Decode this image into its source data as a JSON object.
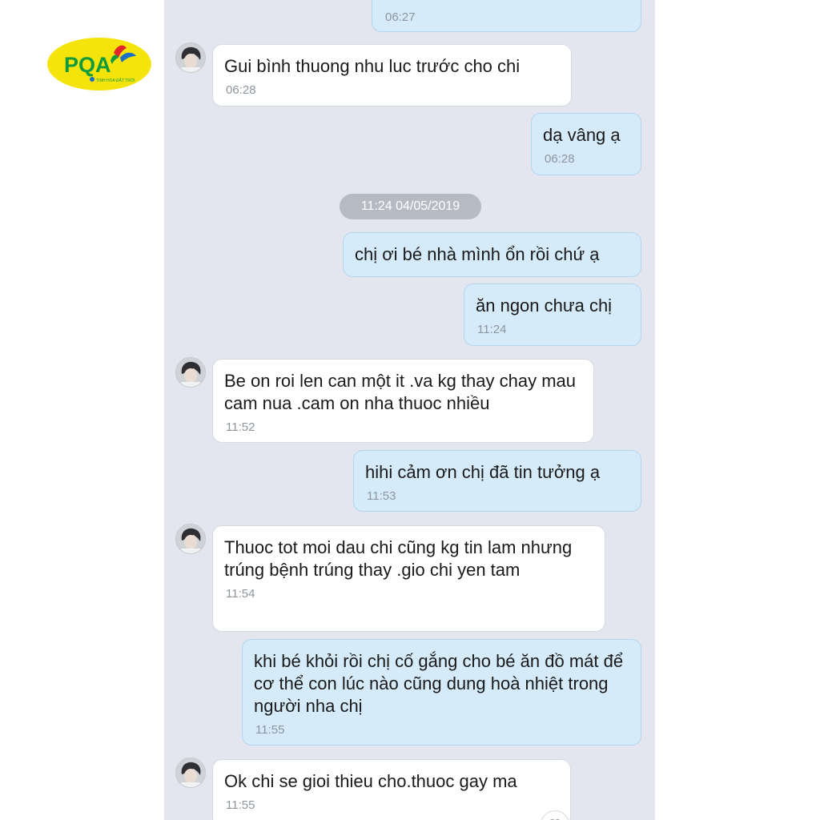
{
  "logo": {
    "brand": "PQA",
    "tagline": "TINH HOA ĐẤT TRỜI",
    "colors": {
      "yellow": "#f4e40c",
      "green": "#0f9b3c",
      "red": "#e3262e",
      "blue": "#1c6fc4"
    }
  },
  "chat": {
    "background": "#e3e6ee",
    "date_divider": "11:24 04/05/2019",
    "messages": [
      {
        "side": "out",
        "text": "",
        "time": "06:27"
      },
      {
        "side": "in",
        "text": "Gui bình thuong nhu luc trước cho chi",
        "time": "06:28"
      },
      {
        "side": "out",
        "text": "dạ vâng ạ",
        "time": "06:28"
      },
      {
        "side": "out",
        "text": "chị ơi bé nhà mình ổn rồi chứ ạ",
        "time": ""
      },
      {
        "side": "out",
        "text": "ăn ngon chưa chị",
        "time": "11:24"
      },
      {
        "side": "in",
        "text": "Be on roi len can một it .va kg thay chay mau cam nua .cam on nha thuoc nhiều",
        "time": "11:52"
      },
      {
        "side": "out",
        "text": "hihi cảm ơn chị đã tin tưởng ạ",
        "time": "11:53"
      },
      {
        "side": "in",
        "text": "Thuoc tot moi dau chi cũng kg tin lam nhưng trúng bệnh trúng thay .gio chi yen tam",
        "time": "11:54"
      },
      {
        "side": "out",
        "text": "khi bé khỏi rồi chị cố gắng cho bé ăn đồ mát để cơ thể con lúc nào cũng dung hoà nhiệt trong người nha chị",
        "time": "11:55"
      },
      {
        "side": "in",
        "text": "Ok chi se gioi thieu cho.thuoc gay ma",
        "time": "11:55"
      }
    ]
  }
}
